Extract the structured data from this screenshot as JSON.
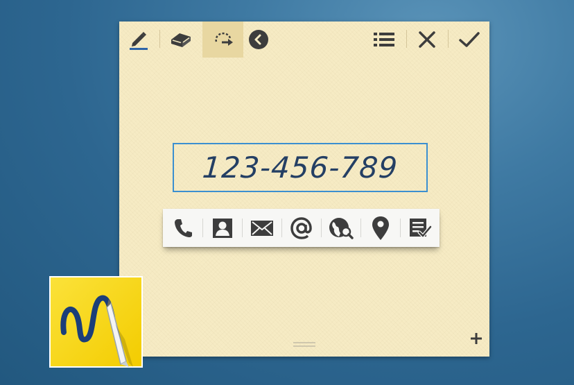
{
  "toolbar": {
    "left_tools": [
      "pen-icon",
      "eraser-icon",
      "lasso-selection-icon",
      "back-icon"
    ],
    "selected_tool": "lasso-selection-icon",
    "right_tools": [
      "list-icon",
      "close-icon",
      "check-icon"
    ]
  },
  "recognized": {
    "text": "123-456-789"
  },
  "action_bar": {
    "actions": [
      "phone-icon",
      "contact-icon",
      "email-icon",
      "at-icon",
      "web-search-icon",
      "location-icon",
      "memo-icon"
    ]
  },
  "colors": {
    "paper": "#f6ebc4",
    "selection_border": "#3b8fd0",
    "ink": "#243f64",
    "app_icon_bg": "#f7d816"
  }
}
